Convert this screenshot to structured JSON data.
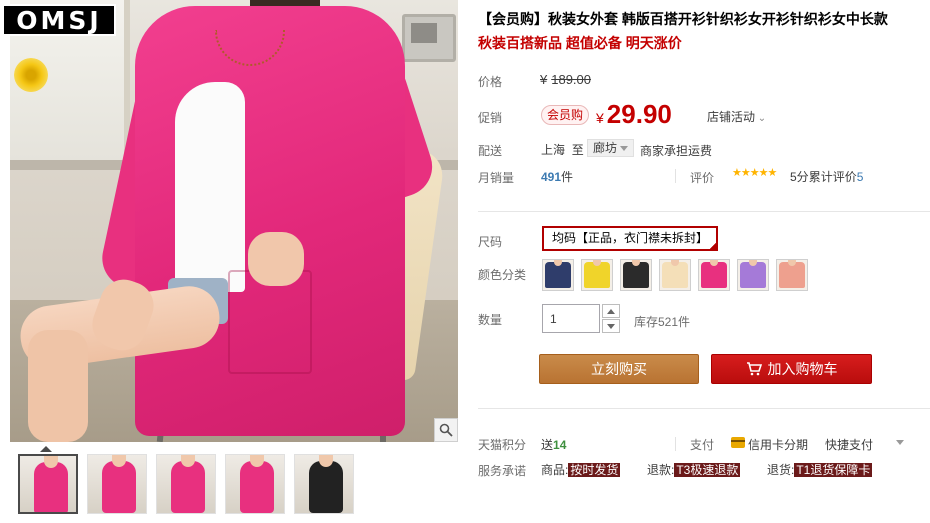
{
  "brand": {
    "logo_text": "OMSJ"
  },
  "product": {
    "title": "【会员购】秋装女外套 韩版百搭开衫针织衫女开衫针织衫女中长款",
    "subtitle": "秋装百搭新品 超值必备 明天涨价"
  },
  "price": {
    "label": "价格",
    "currency": "¥",
    "original": "189.00"
  },
  "promo": {
    "label": "促销",
    "member_badge": "会员购",
    "currency": "¥",
    "price": "29.90",
    "store_activity": "店铺活动"
  },
  "shipping": {
    "label": "配送",
    "from": "上海",
    "to_word": "至",
    "destination": "廊坊",
    "fee_note": "商家承担运费"
  },
  "sales": {
    "label": "月销量",
    "count": "491",
    "unit": "件",
    "rating_label": "评价",
    "stars": "★★★★★",
    "rating_score": "5分",
    "reviews_text": "累计评价",
    "reviews_count": "5"
  },
  "options": {
    "size_label": "尺码",
    "size_selected": "均码【正品，衣门襟未拆封】",
    "color_label": "颜色分类",
    "colors": [
      "#2f3d6b",
      "#f0d42a",
      "#2b2b2b",
      "#f4dfb8",
      "#e8307f",
      "#a57ad8",
      "#eea08e"
    ]
  },
  "quantity": {
    "label": "数量",
    "value": "1",
    "stock": "库存521件"
  },
  "actions": {
    "buy_now": "立刻购买",
    "add_to_cart": "加入购物车"
  },
  "points": {
    "label": "天猫积分",
    "prefix": "送",
    "value": "14"
  },
  "payment": {
    "label": "支付",
    "credit": "信用卡分期",
    "quick": "快捷支付"
  },
  "services": {
    "label": "服务承诺",
    "goods_prefix": "商品:",
    "goods_tag": "按时发货",
    "refund_prefix": "退款:",
    "refund_tag": "T3极速退款",
    "return_prefix": "退货:",
    "return_tag": "T1退货保障卡"
  },
  "gallery": {
    "thumb_colors": [
      "#e8307f",
      "#e8307f",
      "#e8307f",
      "#e8307f",
      "#222222"
    ]
  },
  "colors": {
    "accent_red": "#c40000",
    "buy_button": "#c48040",
    "cart_button": "#c81414"
  }
}
